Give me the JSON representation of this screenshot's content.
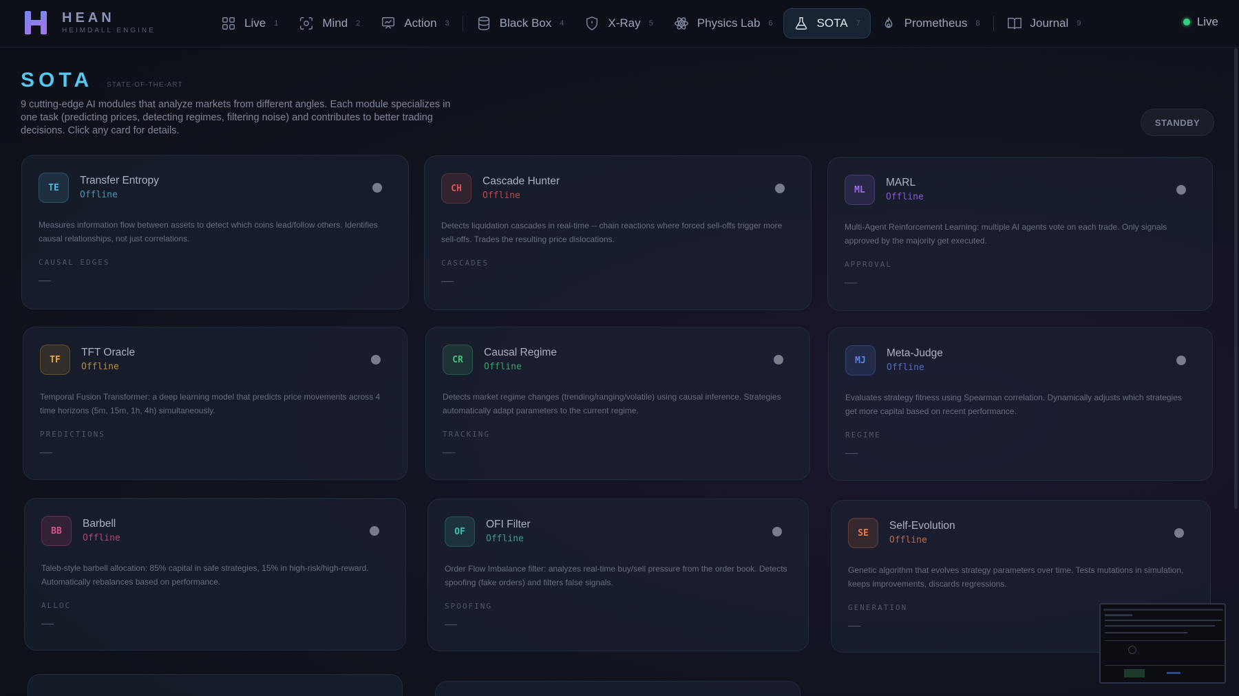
{
  "brand": {
    "name": "HEAN",
    "subtitle": "HEIMDALL ENGINE"
  },
  "nav": [
    {
      "label": "Live",
      "num": "1",
      "icon": "grid-icon"
    },
    {
      "label": "Mind",
      "num": "2",
      "icon": "scan-icon"
    },
    {
      "label": "Action",
      "num": "3",
      "icon": "board-icon"
    },
    {
      "label": "Black Box",
      "num": "4",
      "icon": "database-icon"
    },
    {
      "label": "X-Ray",
      "num": "5",
      "icon": "shield-icon"
    },
    {
      "label": "Physics Lab",
      "num": "6",
      "icon": "atom-icon"
    },
    {
      "label": "SOTA",
      "num": "7",
      "icon": "flask-icon",
      "active": true
    },
    {
      "label": "Prometheus",
      "num": "8",
      "icon": "flame-icon"
    },
    {
      "label": "Journal",
      "num": "9",
      "icon": "book-icon"
    }
  ],
  "status": {
    "label": "Live",
    "color": "#35d07f"
  },
  "page": {
    "title": "SOTA",
    "subtitle": "STATE-OF-THE-ART",
    "description": "9 cutting-edge AI modules that analyze markets from different angles. Each module specializes in one task (predicting prices, detecting regimes, filtering noise) and contributes to better trading decisions. Click any card for details.",
    "standby_label": "STANDBY"
  },
  "cards": [
    {
      "abbr": "TE",
      "name": "Transfer Entropy",
      "state": "Offline",
      "accent": "#4fb8e0",
      "description": "Measures information flow between assets to detect which coins lead/follow others. Identifies causal relationships, not just correlations.",
      "metric": "CAUSAL EDGES",
      "value": "——"
    },
    {
      "abbr": "CH",
      "name": "Cascade Hunter",
      "state": "Offline",
      "accent": "#e05555",
      "description": "Detects liquidation cascades in real-time -- chain reactions where forced sell-offs trigger more sell-offs. Trades the resulting price dislocations.",
      "metric": "CASCADES",
      "value": "——"
    },
    {
      "abbr": "ML",
      "name": "MARL",
      "state": "Offline",
      "accent": "#9d6cf0",
      "description": "Multi-Agent Reinforcement Learning: multiple AI agents vote on each trade. Only signals approved by the majority get executed.",
      "metric": "APPROVAL",
      "value": "——"
    },
    {
      "abbr": "TF",
      "name": "TFT Oracle",
      "state": "Offline",
      "accent": "#e8a93a",
      "description": "Temporal Fusion Transformer: a deep learning model that predicts price movements across 4 time horizons (5m, 15m, 1h, 4h) simultaneously.",
      "metric": "PREDICTIONS",
      "value": "——"
    },
    {
      "abbr": "CR",
      "name": "Causal Regime",
      "state": "Offline",
      "accent": "#45c27a",
      "description": "Detects market regime changes (trending/ranging/volatile) using causal inference. Strategies automatically adapt parameters to the current regime.",
      "metric": "TRACKING",
      "value": "——"
    },
    {
      "abbr": "MJ",
      "name": "Meta-Judge",
      "state": "Offline",
      "accent": "#5a86e8",
      "description": "Evaluates strategy fitness using Spearman correlation. Dynamically adjusts which strategies get more capital based on recent performance.",
      "metric": "REGIME",
      "value": "——"
    },
    {
      "abbr": "BB",
      "name": "Barbell",
      "state": "Offline",
      "accent": "#e0508a",
      "description": "Taleb-style barbell allocation: 85% capital in safe strategies, 15% in high-risk/high-reward. Automatically rebalances based on performance.",
      "metric": "ALLOC",
      "value": "——"
    },
    {
      "abbr": "OF",
      "name": "OFI Filter",
      "state": "Offline",
      "accent": "#3cc0b4",
      "description": "Order Flow Imbalance filter: analyzes real-time buy/sell pressure from the order book. Detects spoofing (fake orders) and filters false signals.",
      "metric": "SPOOFING",
      "value": "——"
    },
    {
      "abbr": "SE",
      "name": "Self-Evolution",
      "state": "Offline",
      "accent": "#ef7a3c",
      "description": "Genetic algorithm that evolves strategy parameters over time. Tests mutations in simulation, keeps improvements, discards regressions.",
      "metric": "GENERATION",
      "value": "——"
    }
  ]
}
